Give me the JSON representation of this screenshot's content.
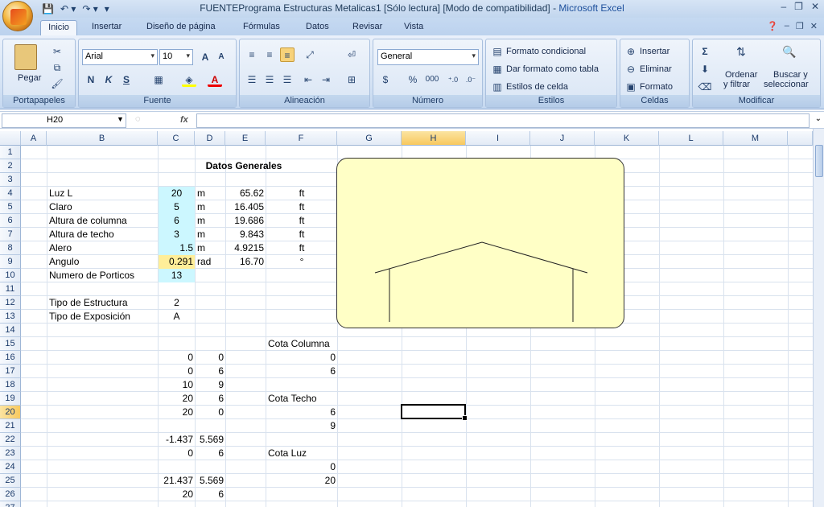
{
  "window": {
    "title_doc": "FUENTEPrograma Estructuras Metalicas1  [Sólo lectura]  [Modo de compatibilidad] - ",
    "title_app": "Microsoft Excel"
  },
  "tabs": [
    "Inicio",
    "Insertar",
    "Diseño de página",
    "Fórmulas",
    "Datos",
    "Revisar",
    "Vista"
  ],
  "ribbon": {
    "portapapeles": {
      "label": "Portapapeles",
      "paste": "Pegar"
    },
    "fuente": {
      "label": "Fuente",
      "font_name": "Arial",
      "font_size": "10",
      "bold": "N",
      "italic": "K",
      "underline": "S"
    },
    "alineacion": {
      "label": "Alineación"
    },
    "numero": {
      "label": "Número",
      "format": "General",
      "percent": "%",
      "thousands": "000"
    },
    "estilos": {
      "label": "Estilos",
      "conditional": "Formato condicional",
      "table": "Dar formato como tabla",
      "cell_styles": "Estilos de celda"
    },
    "celdas": {
      "label": "Celdas",
      "insert": "Insertar",
      "delete": "Eliminar",
      "format": "Formato"
    },
    "modificar": {
      "label": "Modificar",
      "sort": "Ordenar",
      "sort2": "y filtrar",
      "find": "Buscar y",
      "find2": "seleccionar"
    }
  },
  "formula_bar": {
    "name_box": "H20",
    "fx": "fx",
    "formula": ""
  },
  "columns": [
    "A",
    "B",
    "C",
    "D",
    "E",
    "F",
    "G",
    "H",
    "I",
    "J",
    "K",
    "L",
    "M"
  ],
  "rows": [
    "1",
    "2",
    "3",
    "4",
    "5",
    "6",
    "7",
    "8",
    "9",
    "10",
    "11",
    "12",
    "13",
    "14",
    "15",
    "16",
    "17",
    "18",
    "19",
    "20",
    "21",
    "22",
    "23",
    "24",
    "25",
    "26",
    "27"
  ],
  "sheet": {
    "title": "Datos Generales",
    "labels": {
      "r4": "Luz L",
      "r5": "Claro",
      "r6": "Altura de columna",
      "r7": "Altura de techo",
      "r8": "Alero",
      "r9": "Angulo",
      "r10": "Numero de Porticos",
      "r12": "Tipo de Estructura",
      "r13": "Tipo de Exposición"
    },
    "c_values": {
      "r4": "20",
      "r5": "5",
      "r6": "6",
      "r7": "3",
      "r8": "1.5",
      "r9": "0.291",
      "r10": "13",
      "r12": "2",
      "r13": "A"
    },
    "d_units": {
      "r4": "m",
      "r5": "m",
      "r6": "m",
      "r7": "m",
      "r8": "m",
      "r9": "rad"
    },
    "e_values": {
      "r4": "65.62",
      "r5": "16.405",
      "r6": "19.686",
      "r7": "9.843",
      "r8": "4.9215",
      "r9": "16.70"
    },
    "f_units": {
      "r4": "ft",
      "r5": "ft",
      "r6": "ft",
      "r7": "ft",
      "r8": "ft",
      "r9": "°"
    },
    "coords_c": {
      "r16": "0",
      "r17": "0",
      "r18": "10",
      "r19": "20",
      "r20": "20",
      "r22": "-1.437",
      "r23": "0",
      "r25": "21.437",
      "r26": "20"
    },
    "coords_d": {
      "r16": "0",
      "r17": "6",
      "r18": "9",
      "r19": "6",
      "r20": "0",
      "r22": "5.569",
      "r23": "6",
      "r25": "5.569",
      "r26": "6"
    },
    "cota_columna": "Cota Columna",
    "cota_techo": "Cota Techo",
    "cota_luz": "Cota Luz",
    "f_values": {
      "r16": "0",
      "r17": "6",
      "r20": "6",
      "r21": "9",
      "r24": "0",
      "r25": "20"
    }
  }
}
